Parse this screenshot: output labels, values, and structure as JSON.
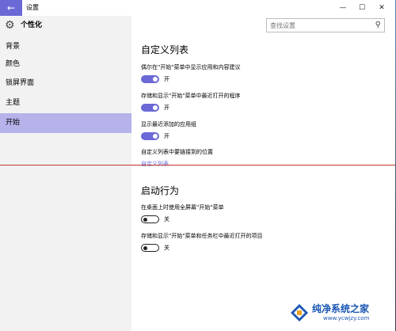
{
  "window": {
    "title": "设置",
    "minimize": "—",
    "maximize": "☐",
    "close": "✕"
  },
  "sidebar": {
    "title": "个性化",
    "items": [
      {
        "label": "背景"
      },
      {
        "label": "颜色"
      },
      {
        "label": "锁屏界面"
      },
      {
        "label": "主题"
      },
      {
        "label": "开始",
        "active": true
      }
    ]
  },
  "search": {
    "placeholder": "查找设置"
  },
  "sections": {
    "custom_list": {
      "heading": "自定义列表",
      "settings": [
        {
          "label": "偶尔在\"开始\"菜单中显示应用和内容建议",
          "state": "开",
          "on": true
        },
        {
          "label": "存储和显示\"开始\"菜单中最近打开的程序",
          "state": "开",
          "on": true
        },
        {
          "label": "显示最近添加的应用组",
          "state": "开",
          "on": true
        }
      ],
      "link_caption": "自定义列表中要链接到的位置",
      "link": "自定义列表"
    },
    "startup": {
      "heading": "启动行为",
      "settings": [
        {
          "label": "在桌面上时使用全屏幕\"开始\"菜单",
          "state": "关",
          "on": false
        },
        {
          "label": "存储和显示\"开始\"菜单和任务栏中最近打开的项目",
          "state": "关",
          "on": false
        }
      ]
    }
  },
  "watermark": {
    "text": "纯净系统之家",
    "url": "www.ycwjzy.com"
  },
  "colors": {
    "accent": "#6b69d6",
    "sidebar_bg": "#f2f2f2",
    "active_bg": "#b5b3ea"
  }
}
